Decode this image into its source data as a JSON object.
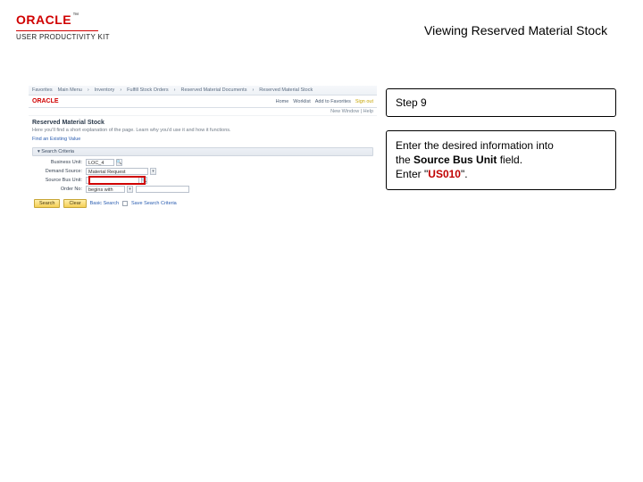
{
  "header": {
    "brand": "ORACLE",
    "tm": "™",
    "subtitle": "USER PRODUCTIVITY KIT",
    "page_title": "Viewing Reserved Material Stock"
  },
  "shot": {
    "breadcrumb": [
      "Favorites",
      "Main Menu",
      "Inventory",
      "Fulfill Stock Orders",
      "Reserved Material Documents",
      "Reserved Material Stock"
    ],
    "brand": "ORACLE",
    "nav": [
      "Home",
      "Worklist",
      "Add to Favorites",
      "Sign out"
    ],
    "subnav": "New Window | Help",
    "h1": "Reserved Material Stock",
    "desc": "Here you'll find a short explanation of the page. Learn why you'd use it and how it functions.",
    "link": "Find an Existing Value",
    "collapse": "Search Criteria",
    "rows": {
      "business_unit": {
        "label": "Business Unit:",
        "value": "LOC_4"
      },
      "demand_source": {
        "label": "Demand Source:",
        "value": "Material Request"
      },
      "source_bus_unit": {
        "label": "Source Bus Unit:",
        "value": ""
      },
      "order_no": {
        "label": "Order No:",
        "op": "begins with",
        "value": ""
      }
    },
    "buttons": {
      "search": "Search",
      "clear": "Clear",
      "basic": "Basic Search",
      "save": "Save Search Criteria"
    }
  },
  "step": {
    "label": "Step 9"
  },
  "instruction": {
    "l1a": "Enter the desired information into",
    "l1b": "the ",
    "field": "Source Bus Unit",
    "l1c": " field.",
    "l2a": "Enter \"",
    "value": "US010",
    "l2b": "\"."
  }
}
